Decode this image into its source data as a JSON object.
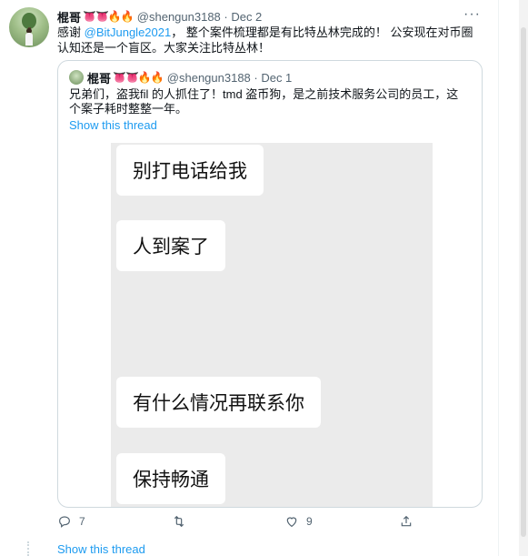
{
  "tweet": {
    "name": "棍哥",
    "emojis": "👅👅🔥🔥",
    "handle_date": "@shengun3188 · Dec 2",
    "text_before": "感谢 ",
    "mention": "@BitJungle2021",
    "text_after": "， 整个案件梳理都是有比特丛林完成的！ 公安现在对币圈认知还是一个盲区。大家关注比特丛林！",
    "more": "···"
  },
  "quote": {
    "name": "棍哥",
    "emojis": "👅👅🔥🔥",
    "handle_date": "@shengun3188 · Dec 1",
    "text": "兄弟们，盗我fil 的人抓住了！tmd 盗币狗，是之前技术服务公司的员工，这个案子耗时整整一年。",
    "show_thread": "Show this thread",
    "messages": [
      "别打电话给我",
      "人到案了",
      "有什么情况再联系你",
      "保持畅通"
    ]
  },
  "actions": {
    "reply_count": "7",
    "retweet_count": "",
    "like_count": "9"
  },
  "show_thread": "Show this thread"
}
